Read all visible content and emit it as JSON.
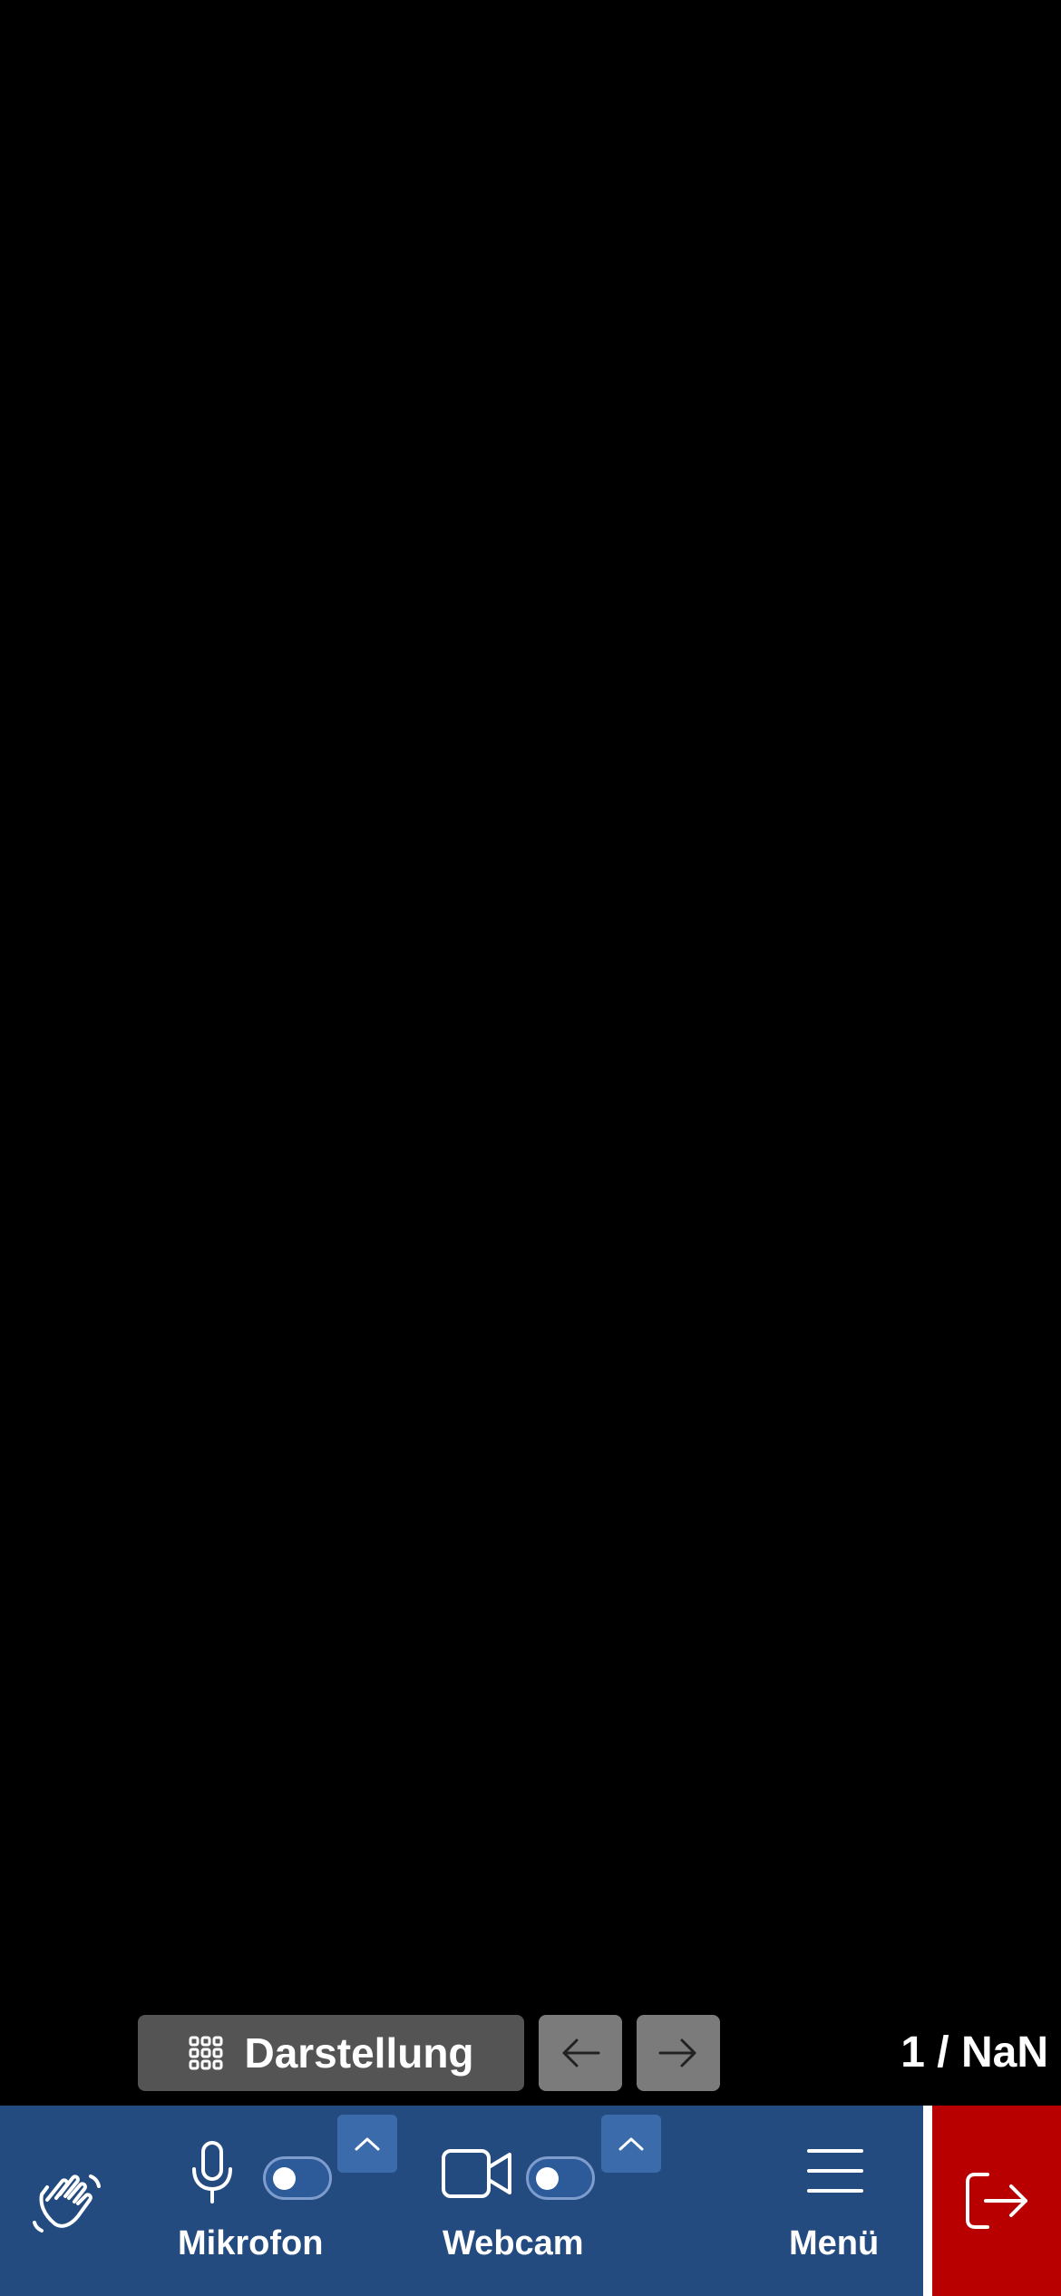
{
  "view": {
    "label": "Darstellung",
    "icon": "grid-icon"
  },
  "pagination": {
    "counter": "1 / NaN",
    "prev_icon": "arrow-left-icon",
    "next_icon": "arrow-right-icon"
  },
  "toolbar": {
    "raise_hand_icon": "hand-wave-icon",
    "mic": {
      "label": "Mikrofon",
      "icon": "microphone-icon",
      "toggle_on": false
    },
    "webcam": {
      "label": "Webcam",
      "icon": "video-camera-icon",
      "toggle_on": false
    },
    "menu": {
      "label": "Menü",
      "icon": "hamburger-icon"
    },
    "leave_icon": "exit-icon"
  },
  "colors": {
    "toolbar_bg": "#234b7f",
    "leave_bg": "#b80000",
    "view_btn_bg": "#545454",
    "nav_btn_bg": "#7b7b7b"
  }
}
